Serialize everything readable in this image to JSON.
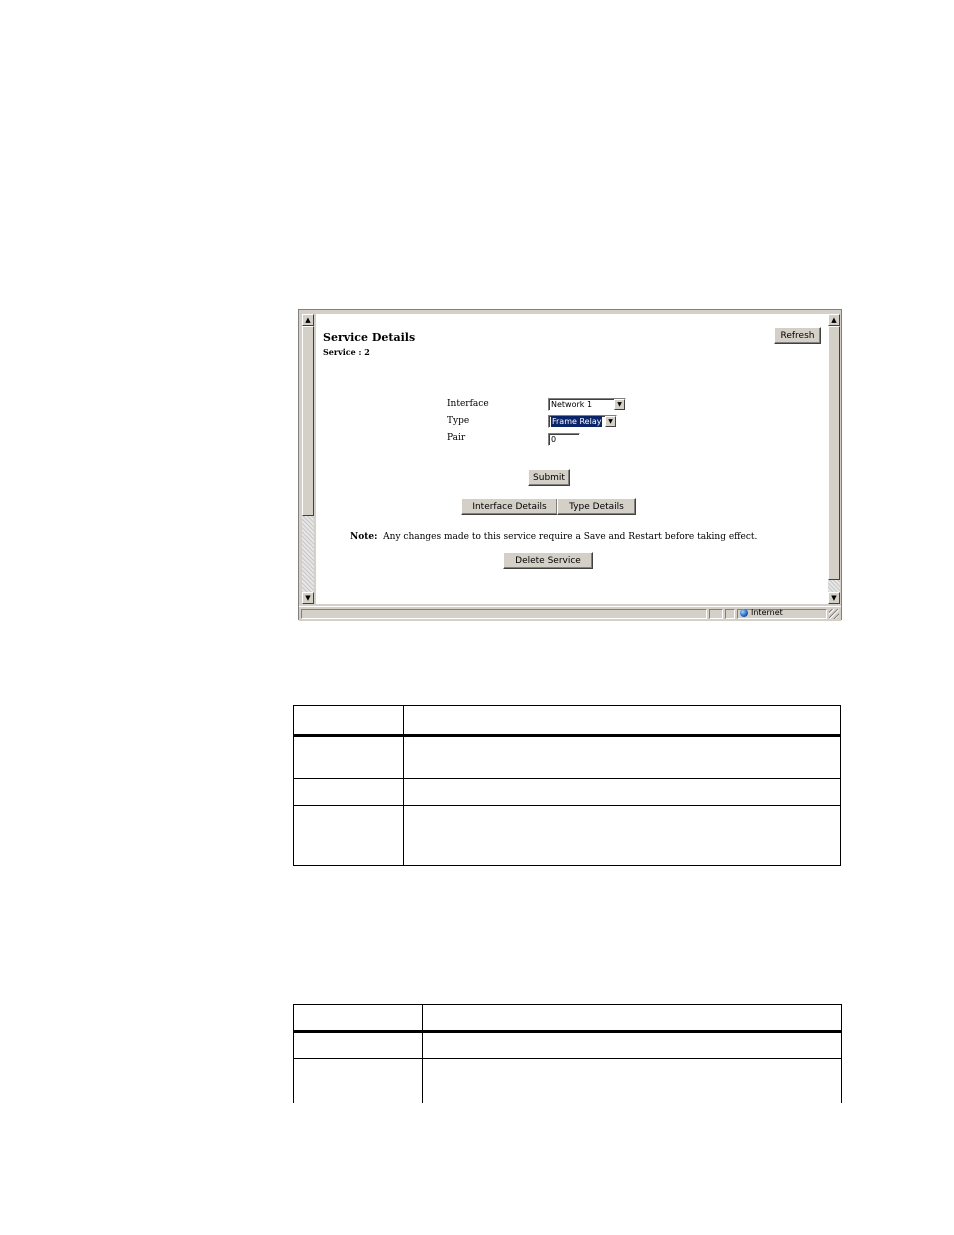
{
  "browser": {
    "page": {
      "title": "Service Details",
      "subtitle": "Service : 2",
      "refresh_label": "Refresh",
      "form": {
        "interface_label": "Interface",
        "interface_value": "Network 1",
        "type_label": "Type",
        "type_value": "Frame Relay",
        "pair_label": "Pair",
        "pair_value": "0"
      },
      "submit_label": "Submit",
      "tabs": [
        {
          "label": "Interface Details"
        },
        {
          "label": "Type Details"
        }
      ],
      "note_label": "Note:",
      "note_text": "Any changes made to this service require a Save and Restart before taking effect.",
      "delete_label": "Delete Service"
    },
    "status": {
      "zone": "Internet"
    }
  },
  "tables": [
    {
      "rows": 4
    },
    {
      "rows": 3
    }
  ]
}
